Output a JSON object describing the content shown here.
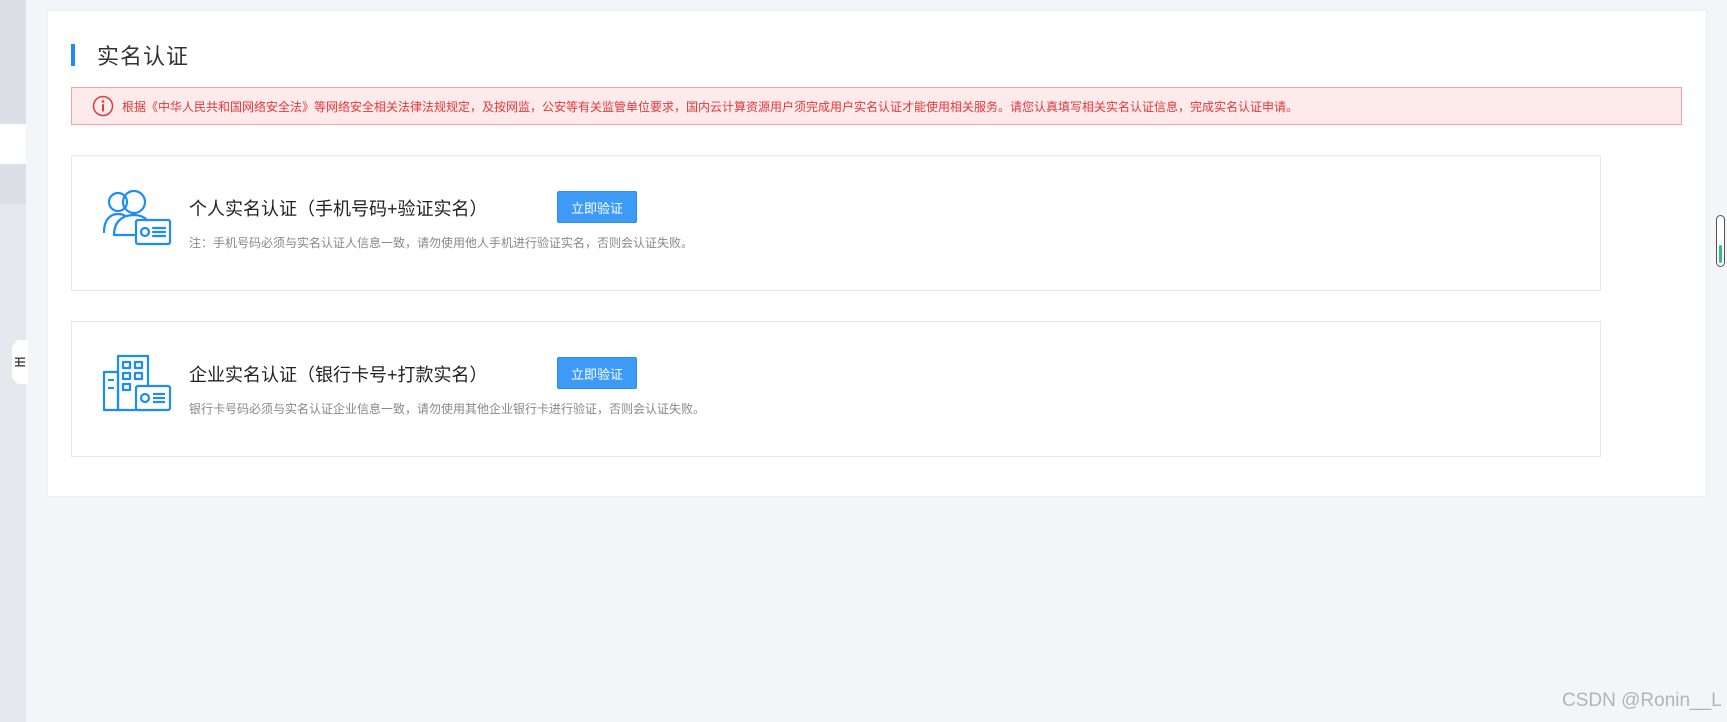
{
  "page": {
    "title": "实名认证",
    "accent_color": "#1d8cf8"
  },
  "notice": {
    "icon": "info-circle-icon",
    "text": "根据《中华人民共和国网络安全法》等网络安全相关法律法规规定，及按网监，公安等有关监管单位要求，国内云计算资源用户须完成用户实名认证才能使用相关服务。请您认真填写相关实名认证信息，完成实名认证申请。",
    "color": "#e4393c"
  },
  "cards": [
    {
      "icon": "person-id-card-icon",
      "title": "个人实名认证（手机号码+验证实名）",
      "button_label": "立即验证",
      "note": "注：手机号码必须与实名认证人信息一致，请勿使用他人手机进行验证实名，否则会认证失败。"
    },
    {
      "icon": "building-id-card-icon",
      "title": "企业实名认证（银行卡号+打款实名）",
      "button_label": "立即验证",
      "note": "银行卡号码必须与实名认证企业信息一致，请勿使用其他企业银行卡进行验证，否则会认证失败。"
    }
  ],
  "watermark": "CSDN @Ronin__L"
}
